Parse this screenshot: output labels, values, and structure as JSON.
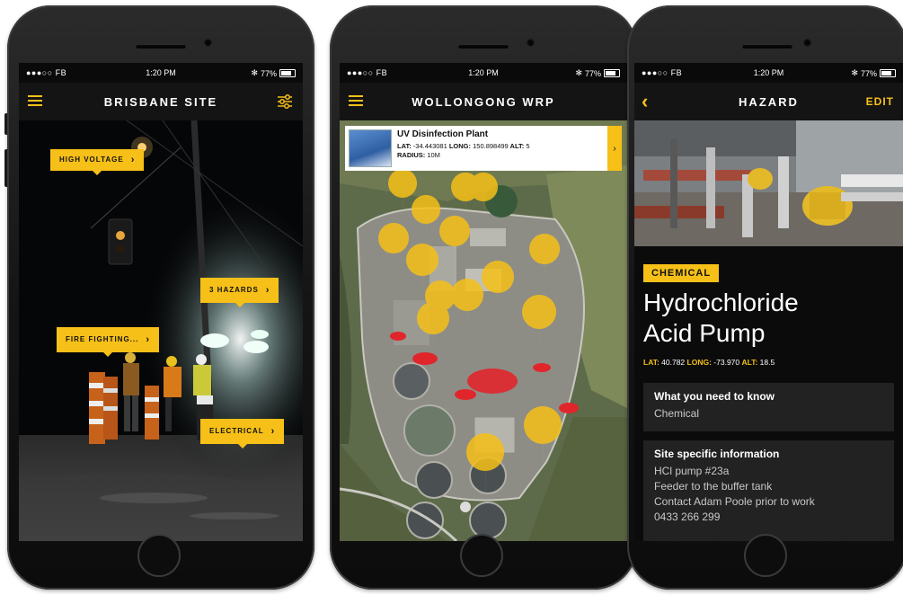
{
  "status": {
    "carrier": "●●●○○ FB",
    "time": "1:20 PM",
    "battery": "77%"
  },
  "screen1": {
    "title": "BRISBANE SITE",
    "tags": [
      {
        "label": "HIGH VOLTAGE"
      },
      {
        "label": "3 HAZARDS"
      },
      {
        "label": "FIRE FIGHTING..."
      },
      {
        "label": "ELECTRICAL"
      }
    ]
  },
  "screen2": {
    "title": "WOLLONGONG WRP",
    "callout": {
      "title": "UV Disinfection Plant",
      "lat_label": "LAT:",
      "lat": "-34.443081",
      "long_label": "LONG:",
      "long": "150.898499",
      "alt_label": "ALT:",
      "alt": "5",
      "radius_label": "RADIUS:",
      "radius": "10M"
    }
  },
  "screen3": {
    "title": "HAZARD",
    "edit_label": "EDIT",
    "category": "CHEMICAL",
    "hazard_name_line1": "Hydrochloride",
    "hazard_name_line2": "Acid Pump",
    "lat_label": "LAT:",
    "lat": "40.782",
    "long_label": "LONG:",
    "long": "-73.970",
    "alt_label": "ALT:",
    "alt": "18.5",
    "cards": [
      {
        "heading": "What you need to know",
        "lines": [
          "Chemical"
        ]
      },
      {
        "heading": "Site specific information",
        "lines": [
          "HCl pump #23a",
          "Feeder to the buffer tank",
          "Contact Adam Poole prior to work",
          "0433 266 299"
        ]
      }
    ]
  },
  "colors": {
    "accent": "#f6c018",
    "marker_red": "#e0262b",
    "bg": "#0a0a0a"
  },
  "icons": [
    "menu-icon",
    "filter-icon",
    "back-icon",
    "wifi-icon",
    "bluetooth-icon",
    "battery-icon",
    "chevron-right-icon",
    "map-pin-icon"
  ]
}
